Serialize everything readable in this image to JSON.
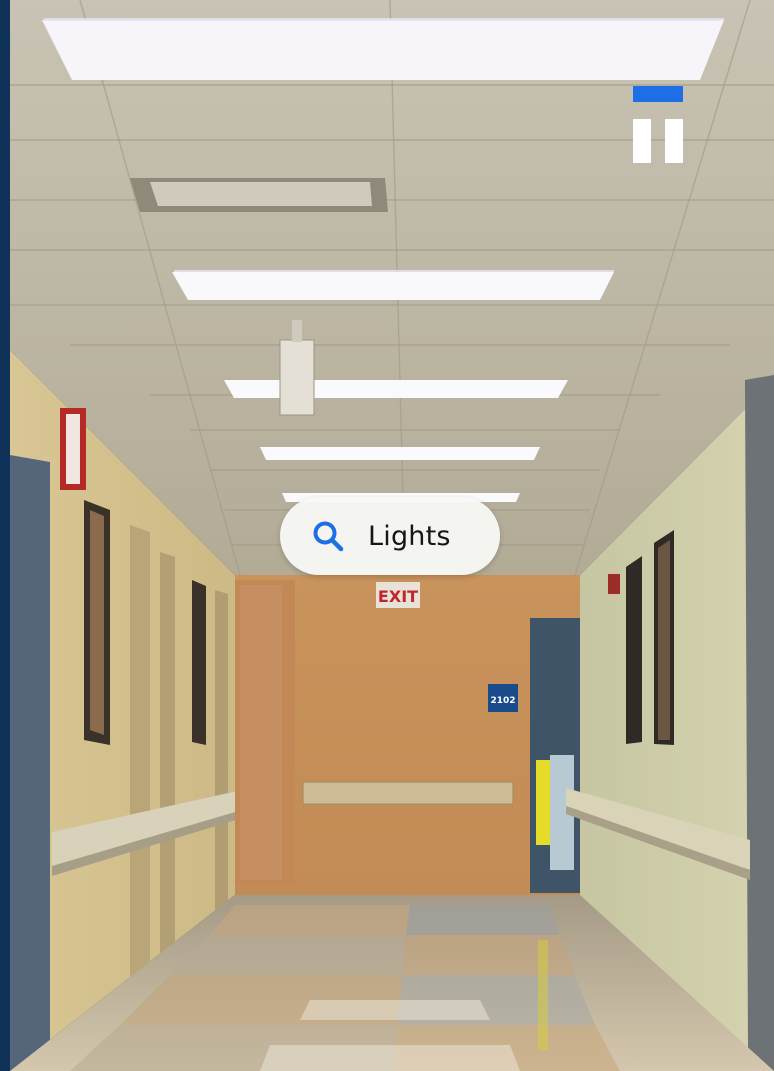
{
  "search": {
    "label": "Lights",
    "icon": "search-icon",
    "icon_color": "#1e6fe6"
  },
  "controls": {
    "pause_icon": "pause-icon",
    "indicator_color": "#1e6fe6"
  },
  "scene": {
    "exit_sign": "EXIT",
    "room_sign": "2102"
  },
  "colors": {
    "frame": "#0f3358",
    "accent": "#1e6fe6"
  }
}
